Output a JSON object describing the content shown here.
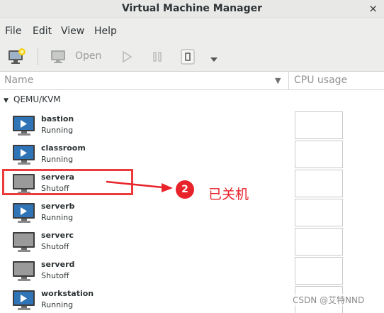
{
  "window": {
    "title": "Virtual Machine Manager",
    "close_symbol": "×"
  },
  "menu": {
    "file": "File",
    "edit": "Edit",
    "view": "View",
    "help": "Help"
  },
  "toolbar": {
    "open_label": "Open"
  },
  "columns": {
    "name": "Name",
    "cpu": "CPU usage"
  },
  "connection": {
    "label": "QEMU/KVM"
  },
  "vms": [
    {
      "name": "bastion",
      "status": "Running",
      "state": "running"
    },
    {
      "name": "classroom",
      "status": "Running",
      "state": "running"
    },
    {
      "name": "servera",
      "status": "Shutoff",
      "state": "shutoff"
    },
    {
      "name": "serverb",
      "status": "Running",
      "state": "running"
    },
    {
      "name": "serverc",
      "status": "Shutoff",
      "state": "shutoff"
    },
    {
      "name": "serverd",
      "status": "Shutoff",
      "state": "shutoff"
    },
    {
      "name": "workstation",
      "status": "Running",
      "state": "running"
    }
  ],
  "annotation": {
    "badge": "2",
    "text": "已关机"
  },
  "watermark": "CSDN @艾特NND",
  "colors": {
    "annotation_red": "#e8232a",
    "running_screen": "#2f74b7",
    "shutoff_screen": "#9a9a9a"
  },
  "icons": {
    "new_vm": "new-vm-icon",
    "open": "monitor-icon",
    "run": "play-icon",
    "pause": "pause-icon",
    "shutdown": "power-icon",
    "shutdown_menu": "chevron-down-icon"
  }
}
